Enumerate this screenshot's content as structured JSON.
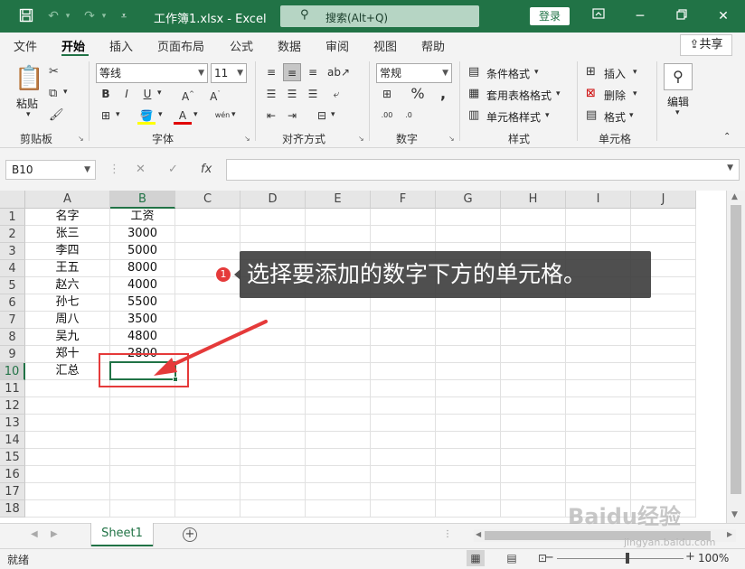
{
  "titlebar": {
    "document_title": "工作簿1.xlsx  -  Excel",
    "search_placeholder": "搜索(Alt+Q)",
    "login_label": "登录"
  },
  "menu": {
    "tabs": [
      "文件",
      "开始",
      "插入",
      "页面布局",
      "公式",
      "数据",
      "审阅",
      "视图",
      "帮助"
    ],
    "active": "开始",
    "share_label": "共享"
  },
  "ribbon": {
    "clipboard": {
      "paste": "粘贴",
      "label": "剪贴板"
    },
    "font": {
      "name": "等线",
      "size": "11",
      "label": "字体"
    },
    "alignment": {
      "label": "对齐方式"
    },
    "number": {
      "format": "常规",
      "label": "数字"
    },
    "styles": {
      "conditional": "条件格式",
      "table": "套用表格格式",
      "cell": "单元格样式",
      "label": "样式"
    },
    "cells": {
      "insert": "插入",
      "delete": "删除",
      "format": "格式",
      "label": "单元格"
    },
    "editing": {
      "label": "编辑"
    }
  },
  "formula_bar": {
    "name_box": "B10",
    "fx": "fx",
    "content": ""
  },
  "sheet": {
    "columns": [
      "A",
      "B",
      "C",
      "D",
      "E",
      "F",
      "G",
      "H",
      "I",
      "J"
    ],
    "rows": [
      "1",
      "2",
      "3",
      "4",
      "5",
      "6",
      "7",
      "8",
      "9",
      "10",
      "11",
      "12",
      "13",
      "14",
      "15",
      "16",
      "17",
      "18"
    ],
    "selected_column": "B",
    "selected_row": "10",
    "data": [
      [
        "名字",
        "工资"
      ],
      [
        "张三",
        "3000"
      ],
      [
        "李四",
        "5000"
      ],
      [
        "王五",
        "8000"
      ],
      [
        "赵六",
        "4000"
      ],
      [
        "孙七",
        "5500"
      ],
      [
        "周八",
        "3500"
      ],
      [
        "吴九",
        "4800"
      ],
      [
        "郑十",
        "2800"
      ],
      [
        "汇总",
        ""
      ]
    ]
  },
  "annotation": {
    "step": "1",
    "text": "选择要添加的数字下方的单元格。"
  },
  "sheet_tabs": {
    "active": "Sheet1"
  },
  "status": {
    "text": "就绪",
    "zoom": "100%"
  },
  "watermark": {
    "main": "Baidu经验",
    "sub": "jingyan.baidu.com"
  },
  "colors": {
    "accent": "#217346",
    "annotation_red": "#e53a3a"
  }
}
